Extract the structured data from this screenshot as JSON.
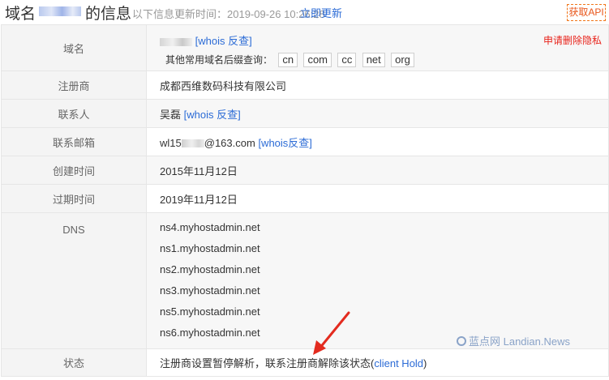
{
  "header": {
    "title_prefix": "域名",
    "title_suffix": "的信息",
    "update_prefix": "以下信息更新时间：2019-09-26 10:26:28",
    "update_link": "立即更新",
    "api_button": "获取API"
  },
  "rows": {
    "domain": {
      "label": "域名",
      "whois_link": "[whois 反查]",
      "suffix_prompt": "其他常用域名后缀查询：",
      "suffixes": [
        "cn",
        "com",
        "cc",
        "net",
        "org"
      ],
      "privacy_link": "申请删除隐私"
    },
    "registrar": {
      "label": "注册商",
      "value": "成都西维数码科技有限公司"
    },
    "contact": {
      "label": "联系人",
      "value": "吴磊",
      "whois_link": "[whois 反查]"
    },
    "email": {
      "label": "联系邮箱",
      "prefix": "wl15",
      "suffix": "@163.com",
      "whois_link": "[whois反查]"
    },
    "created": {
      "label": "创建时间",
      "value": "2015年11月12日"
    },
    "expires": {
      "label": "过期时间",
      "value": "2019年11月12日"
    },
    "dns": {
      "label": "DNS",
      "servers": [
        "ns4.myhostadmin.net",
        "ns1.myhostadmin.net",
        "ns2.myhostadmin.net",
        "ns3.myhostadmin.net",
        "ns5.myhostadmin.net",
        "ns6.myhostadmin.net"
      ]
    },
    "status": {
      "label": "状态",
      "text": "注册商设置暂停解析，联系注册商解除该状态(",
      "link": "client Hold",
      "close": ")"
    }
  },
  "watermark": {
    "text": "蓝点网 Landian.News"
  },
  "colors": {
    "link": "#2b6bd6",
    "privacy": "#e8231b",
    "api_border": "#f0761a",
    "arrow": "#e32b1f"
  }
}
